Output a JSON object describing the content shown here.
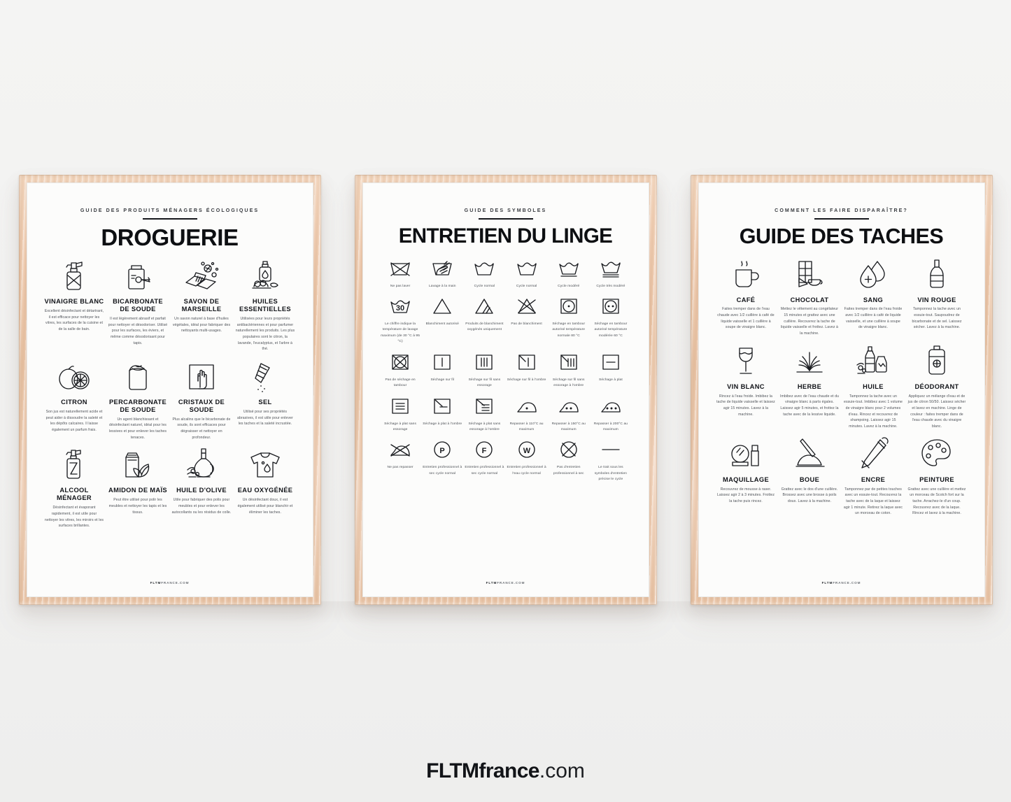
{
  "brand": {
    "name": "FLTMfrance",
    "tld": ".com"
  },
  "poster_footer": {
    "bold": "FLTM",
    "rest": "FRANCE.COM"
  },
  "posters": [
    {
      "id": "droguerie",
      "kicker": "GUIDE DES PRODUITS MÉNAGERS ÉCOLOGIQUES",
      "title": "DROGUERIE",
      "items": [
        {
          "icon": "spray-bottle-icon",
          "title": "VINAIGRE BLANC",
          "desc": "Excellent désinfectant et détartrant, il est efficace pour nettoyer les vitres, les surfaces de la cuisine et de la salle de bain."
        },
        {
          "icon": "baking-soda-jar-icon",
          "title": "BICARBONATE DE SOUDE",
          "desc": "Il est légèrement abrasif et parfait pour nettoyer et désodoriser. Utilisé pour les surfaces, les éviers, et même comme désodorisant pour tapis."
        },
        {
          "icon": "soap-bar-icon",
          "title": "SAVON DE MARSEILLE",
          "desc": "Un savon naturel à base d'huiles végétales, idéal pour fabriquer des nettoyants multi-usages."
        },
        {
          "icon": "essential-oils-icon",
          "title": "HUILES ESSENTIELLES",
          "desc": "Utilisées pour leurs propriétés antibactériennes et pour parfumer naturellement les produits. Les plus populaires sont le citron, la lavande, l'eucalyptus, et l'arbre à thé."
        },
        {
          "icon": "lemon-icon",
          "title": "CITRON",
          "desc": "Son jus est naturellement acide et peut aider à dissoudre la saleté et les dépôts calcaires. Il laisse également un parfum frais."
        },
        {
          "icon": "percarbonate-bag-icon",
          "title": "PERCARBONATE DE SOUDE",
          "desc": "Un agent blanchissant et désinfectant naturel, idéal pour les lessives et pour enlever les taches tenaces."
        },
        {
          "icon": "cleaning-cloth-icon",
          "title": "CRISTAUX DE SOUDE",
          "desc": "Plus alcalins que le bicarbonate de soude, ils sont efficaces pour dégraisser et nettoyer en profondeur."
        },
        {
          "icon": "salt-shaker-icon",
          "title": "SEL",
          "desc": "Utilisé pour ses propriétés abrasives, il est utile pour enlever les taches et la saleté incrustée."
        },
        {
          "icon": "spray-cleaner-icon",
          "title": "ALCOOL MÉNAGER",
          "desc": "Désinfectant et évaporant rapidement, il est utile pour nettoyer les vitres, les miroirs et les surfaces brillantes."
        },
        {
          "icon": "corn-starch-icon",
          "title": "AMIDON DE MAÏS",
          "desc": "Peut être utilisé pour polir les meubles et nettoyer les tapis et les tissus."
        },
        {
          "icon": "olive-oil-icon",
          "title": "HUILE D'OLIVE",
          "desc": "Utile pour fabriquer des polis pour meubles et pour enlever les autocollants ou les résidus de colle."
        },
        {
          "icon": "stained-tshirt-icon",
          "title": "EAU OXYGÉNÉE",
          "desc": "Un désinfectant doux, il est également utilisé pour blanchir et éliminer les taches."
        }
      ]
    },
    {
      "id": "entretien-du-linge",
      "kicker": "GUIDE DES SYMBOLES",
      "title": "ENTRETIEN DU LINGE",
      "symbols": [
        {
          "icon": "no-wash-icon",
          "caption": "Ne pas laver"
        },
        {
          "icon": "hand-wash-icon",
          "caption": "Lavage à la main"
        },
        {
          "icon": "normal-cycle-icon",
          "caption": "Cycle normal"
        },
        {
          "icon": "normal-cycle-2-icon",
          "caption": "Cycle normal"
        },
        {
          "icon": "moderate-cycle-icon",
          "caption": "Cycle modéré"
        },
        {
          "icon": "very-moderate-cycle-icon",
          "caption": "Cycle très modéré"
        },
        {
          "icon": "wash-temperature-icon",
          "caption": "Le chiffre indique la température de lavage maximum (de 30 °C à 95 °C)"
        },
        {
          "icon": "bleach-allowed-icon",
          "caption": "Blanchiment autorisé"
        },
        {
          "icon": "oxygen-bleach-icon",
          "caption": "Produits de blanchiment oxygénés uniquement"
        },
        {
          "icon": "no-bleach-icon",
          "caption": "Pas de blanchiment"
        },
        {
          "icon": "tumble-dry-normal-icon",
          "caption": "Séchage en tambour autorisé température normale 80 °C"
        },
        {
          "icon": "tumble-dry-moderate-icon",
          "caption": "Séchage en tambour autorisé température modérée 60 °C"
        },
        {
          "icon": "no-tumble-dry-icon",
          "caption": "Pas de séchage en tambour"
        },
        {
          "icon": "line-dry-icon",
          "caption": "Séchage sur fil"
        },
        {
          "icon": "drip-dry-icon",
          "caption": "Séchage sur fil sans essorage"
        },
        {
          "icon": "line-dry-shade-icon",
          "caption": "Séchage sur fil à l'ombre"
        },
        {
          "icon": "drip-dry-shade-icon",
          "caption": "Séchage sur fil sans essorage à l'ombre"
        },
        {
          "icon": "flat-dry-icon",
          "caption": "Séchage à plat"
        },
        {
          "icon": "flat-dry-no-wring-icon",
          "caption": "Séchage à plat sans essorage"
        },
        {
          "icon": "flat-dry-shade-icon",
          "caption": "Séchage à plat à l'ombre"
        },
        {
          "icon": "flat-dry-no-wring-shade-icon",
          "caption": "Séchage à plat sans essorage à l'ombre"
        },
        {
          "icon": "iron-low-icon",
          "caption": "Repasser à 110°C au maximum"
        },
        {
          "icon": "iron-medium-icon",
          "caption": "Repasser à 150°C au maximum"
        },
        {
          "icon": "iron-high-icon",
          "caption": "Repasser à 200°C au maximum"
        },
        {
          "icon": "no-iron-icon",
          "caption": "Ne pas repasser"
        },
        {
          "icon": "dryclean-p-icon",
          "caption": "Entretien professionnel à sec cycle normal"
        },
        {
          "icon": "dryclean-f-icon",
          "caption": "Entretien professionnel à sec cycle normal"
        },
        {
          "icon": "wetclean-w-icon",
          "caption": "Entretien professionnel à l'eau cycle normal"
        },
        {
          "icon": "no-dryclean-icon",
          "caption": "Pas d'entretien professionnel à sec"
        },
        {
          "icon": "bar-under-symbol-icon",
          "caption": "Le trait sous les symboles d'entretien précise le cycle"
        }
      ]
    },
    {
      "id": "guide-des-taches",
      "kicker": "COMMENT LES FAIRE DISPARAÎTRE?",
      "title": "GUIDE DES TACHES",
      "items": [
        {
          "icon": "coffee-mug-icon",
          "title": "CAFÉ",
          "desc": "Faites tremper dans de l'eau chaude avec 1/2 cuillère à café de liquide vaisselle et 1 cuillère à soupe de vinaigre blanc."
        },
        {
          "icon": "chocolate-bar-icon",
          "title": "CHOCOLAT",
          "desc": "Mettez le vêtement au congélateur 15 minutes et grattez avec une cuillère. Recouvrez la tache de liquide vaisselle et frottez. Lavez à la machine."
        },
        {
          "icon": "blood-drop-icon",
          "title": "SANG",
          "desc": "Faites tremper dans de l'eau froide avec 1/2 cuillère à café de liquide vaisselle, et une cuillère à soupe de vinaigre blanc."
        },
        {
          "icon": "wine-bottle-icon",
          "title": "VIN ROUGE",
          "desc": "Tamponnez la tache avec un essuie-tout. Saupoudrez de bicarbonate et de sel. Laissez sécher. Lavez à la machine."
        },
        {
          "icon": "white-wine-glass-icon",
          "title": "VIN BLANC",
          "desc": "Rincez à l'eau froide. Imbibez la tache de liquide vaisselle et laissez agir 15 minutes. Lavez à la machine."
        },
        {
          "icon": "grass-icon",
          "title": "HERBE",
          "desc": "Imbibez avec de l'eau chaude et du vinaigre blanc à parts égales. Laissez agir 5 minutes, et frottez la tache avec de la lessive liquide."
        },
        {
          "icon": "oil-bottle-icon",
          "title": "HUILE",
          "desc": "Tamponnez la tache avec un essuie-tout. Imbibez avec 1 volume de vinaigre blanc pour 2 volumes d'eau. Rincez et recouvrez de shampoing. Laissez agir 15 minutes. Lavez à la machine."
        },
        {
          "icon": "deodorant-icon",
          "title": "DÉODORANT",
          "desc": "Appliquez un mélange d'eau et de jus de citron 50/50. Laissez sécher et lavez en machine. Linge de couleur : faites tremper dans de l'eau chaude avec du vinaigre blanc."
        },
        {
          "icon": "makeup-icon",
          "title": "MAQUILLAGE",
          "desc": "Recouvrez de mousse à raser. Laissez agir 2 à 3 minutes. Frottez la tache puis rincez."
        },
        {
          "icon": "mud-icon",
          "title": "BOUE",
          "desc": "Grattez avec le dos d'une cuillère. Brossez avec une brosse à poils doux. Lavez à la machine."
        },
        {
          "icon": "pen-icon",
          "title": "ENCRE",
          "desc": "Tamponnez par de petites touches avec un essuie-tout. Recouvrez la tache avec de la laque et laissez agir 1 minute. Retirez la laque avec un morceau de coton."
        },
        {
          "icon": "paint-palette-icon",
          "title": "PEINTURE",
          "desc": "Grattez avec une cuillère et mettez un morceau de Scotch fort sur la tache. Arrachez-le d'un coup. Recouvrez avec de la laque. Rincez et lavez à la machine."
        }
      ]
    }
  ]
}
